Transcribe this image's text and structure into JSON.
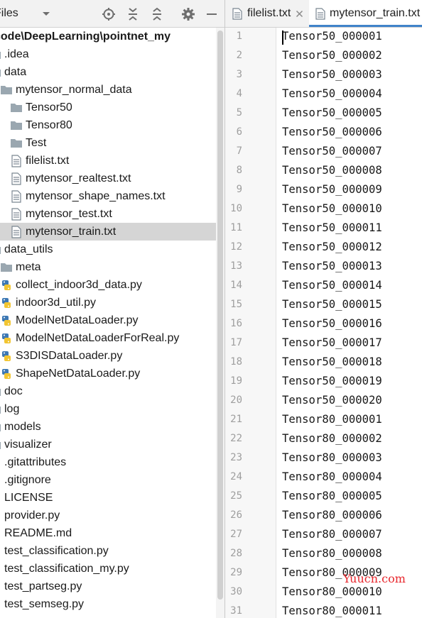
{
  "left_panel": {
    "title": "Files",
    "tree": [
      {
        "label": "code\\DeepLearning\\pointnet_my",
        "type": "root",
        "bold": true
      },
      {
        "label": ".idea",
        "type": "folder"
      },
      {
        "label": "data",
        "type": "folder"
      },
      {
        "label": "mytensor_normal_data",
        "type": "folder"
      },
      {
        "label": "Tensor50",
        "type": "folder"
      },
      {
        "label": "Tensor80",
        "type": "folder"
      },
      {
        "label": "Test",
        "type": "folder"
      },
      {
        "label": "filelist.txt",
        "type": "txt"
      },
      {
        "label": "mytensor_realtest.txt",
        "type": "txt"
      },
      {
        "label": "mytensor_shape_names.txt",
        "type": "txt"
      },
      {
        "label": "mytensor_test.txt",
        "type": "txt"
      },
      {
        "label": "mytensor_train.txt",
        "type": "txt",
        "selected": true
      },
      {
        "label": "data_utils",
        "type": "folder"
      },
      {
        "label": "meta",
        "type": "folder"
      },
      {
        "label": "collect_indoor3d_data.py",
        "type": "py"
      },
      {
        "label": "indoor3d_util.py",
        "type": "py"
      },
      {
        "label": "ModelNetDataLoader.py",
        "type": "py"
      },
      {
        "label": "ModelNetDataLoaderForReal.py",
        "type": "py"
      },
      {
        "label": "S3DISDataLoader.py",
        "type": "py"
      },
      {
        "label": "ShapeNetDataLoader.py",
        "type": "py"
      },
      {
        "label": "doc",
        "type": "folder"
      },
      {
        "label": "log",
        "type": "folder"
      },
      {
        "label": "models",
        "type": "folder"
      },
      {
        "label": "visualizer",
        "type": "folder"
      },
      {
        "label": ".gitattributes",
        "type": "file"
      },
      {
        "label": ".gitignore",
        "type": "file"
      },
      {
        "label": "LICENSE",
        "type": "file"
      },
      {
        "label": "provider.py",
        "type": "py"
      },
      {
        "label": "README.md",
        "type": "file"
      },
      {
        "label": "test_classification.py",
        "type": "py"
      },
      {
        "label": "test_classification_my.py",
        "type": "py"
      },
      {
        "label": "test_partseg.py",
        "type": "py"
      },
      {
        "label": "test_semseg.py",
        "type": "py"
      }
    ]
  },
  "editor": {
    "tabs": [
      {
        "label": "filelist.txt",
        "active": false
      },
      {
        "label": "mytensor_train.txt",
        "active": true
      }
    ],
    "lines": [
      "Tensor50_000001",
      "Tensor50_000002",
      "Tensor50_000003",
      "Tensor50_000004",
      "Tensor50_000005",
      "Tensor50_000006",
      "Tensor50_000007",
      "Tensor50_000008",
      "Tensor50_000009",
      "Tensor50_000010",
      "Tensor50_000011",
      "Tensor50_000012",
      "Tensor50_000013",
      "Tensor50_000014",
      "Tensor50_000015",
      "Tensor50_000016",
      "Tensor50_000017",
      "Tensor50_000018",
      "Tensor50_000019",
      "Tensor50_000020",
      "Tensor80_000001",
      "Tensor80_000002",
      "Tensor80_000003",
      "Tensor80_000004",
      "Tensor80_000005",
      "Tensor80_000006",
      "Tensor80_000007",
      "Tensor80_000008",
      "Tensor80_000009",
      "Tensor80_000010",
      "Tensor80_000011"
    ],
    "watermark": "Yuucn.com"
  },
  "icons": {
    "dropdown": "chevron-down-icon",
    "locate": "target-icon",
    "expand_all": "expand-all-icon",
    "collapse_all": "collapse-all-icon",
    "settings": "gear-icon",
    "hide": "minimize-icon"
  },
  "colors": {
    "selection": "#d5d5d5",
    "folder": "#9aa7b0",
    "tab_underline": "#4083c9",
    "watermark": "#e8262c"
  }
}
